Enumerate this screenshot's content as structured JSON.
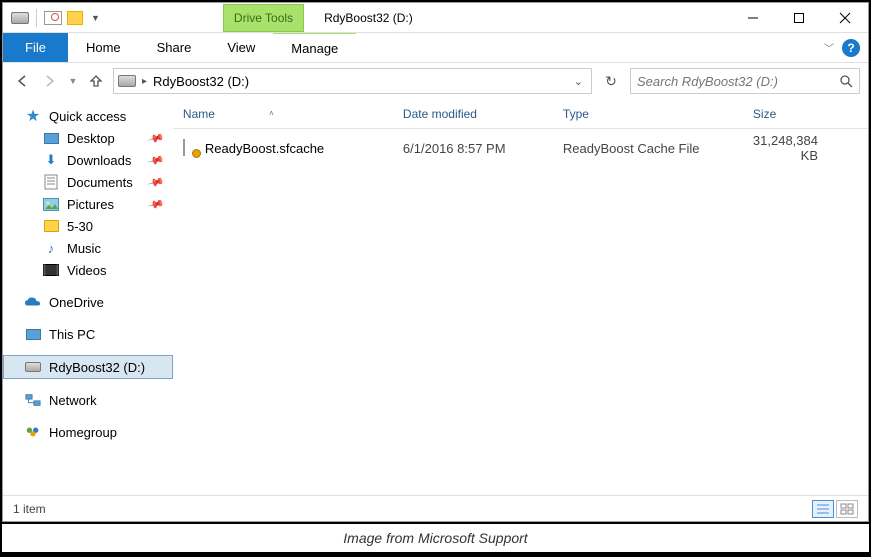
{
  "titlebar": {
    "contextual_tab_label": "Drive Tools",
    "window_title": "RdyBoost32 (D:)"
  },
  "ribbon": {
    "file": "File",
    "home": "Home",
    "share": "Share",
    "view": "View",
    "manage": "Manage"
  },
  "address": {
    "location": "RdyBoost32 (D:)"
  },
  "search": {
    "placeholder": "Search RdyBoost32 (D:)"
  },
  "navpane": {
    "quick_access": "Quick access",
    "desktop": "Desktop",
    "downloads": "Downloads",
    "documents": "Documents",
    "pictures": "Pictures",
    "folder_530": "5-30",
    "music": "Music",
    "videos": "Videos",
    "onedrive": "OneDrive",
    "this_pc": "This PC",
    "rdyboost": "RdyBoost32 (D:)",
    "network": "Network",
    "homegroup": "Homegroup"
  },
  "columns": {
    "name": "Name",
    "date": "Date modified",
    "type": "Type",
    "size": "Size"
  },
  "files": [
    {
      "name": "ReadyBoost.sfcache",
      "date": "6/1/2016 8:57 PM",
      "type": "ReadyBoost Cache File",
      "size": "31,248,384 KB"
    }
  ],
  "status": {
    "count_label": "1 item"
  },
  "caption": "Image from Microsoft Support"
}
